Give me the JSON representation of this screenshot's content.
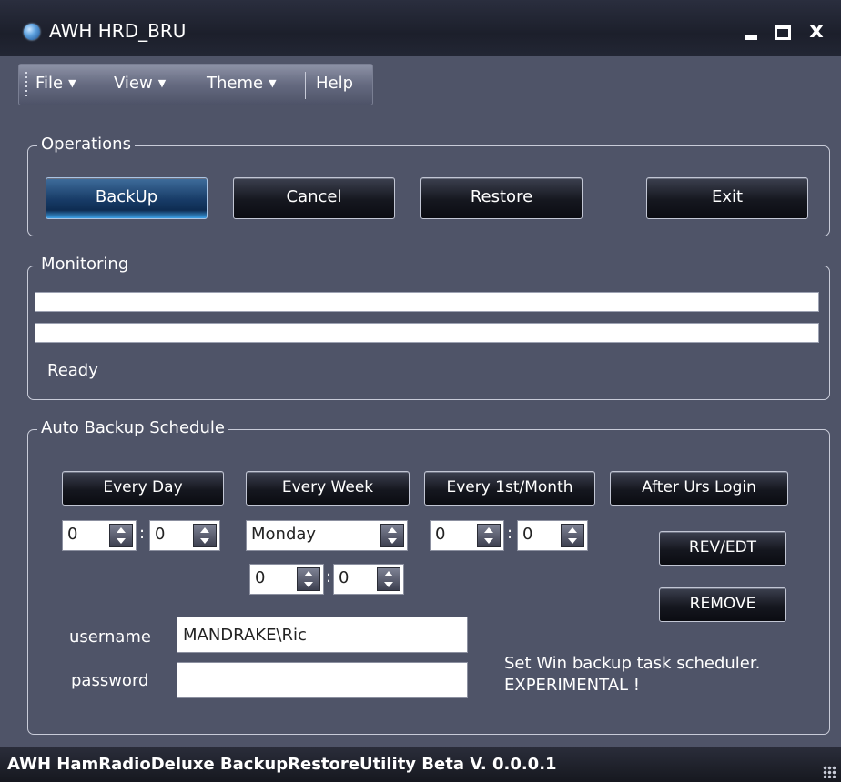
{
  "window": {
    "title": "AWH HRD_BRU",
    "close_label": "x"
  },
  "menu": {
    "items": [
      {
        "label": "File",
        "has_dropdown": true
      },
      {
        "label": "View",
        "has_dropdown": true
      },
      {
        "label": "Theme",
        "has_dropdown": true
      },
      {
        "label": "Help",
        "has_dropdown": false
      }
    ]
  },
  "operations": {
    "legend": "Operations",
    "backup_label": "BackUp",
    "cancel_label": "Cancel",
    "restore_label": "Restore",
    "exit_label": "Exit"
  },
  "monitoring": {
    "legend": "Monitoring",
    "progress1": 0,
    "progress2": 0,
    "status": "Ready"
  },
  "schedule": {
    "legend": "Auto Backup Schedule",
    "every_day_label": "Every Day",
    "every_week_label": "Every Week",
    "every_month_label": "Every 1st/Month",
    "after_login_label": "After Urs Login",
    "day_hour": "0",
    "day_minute": "0",
    "week_day": "Monday",
    "week_hour": "0",
    "week_minute": "0",
    "month_hour": "0",
    "month_minute": "0",
    "time_separator": ":",
    "rev_edt_label": "REV/EDT",
    "remove_label": "REMOVE",
    "username_label": "username",
    "username_value": "MANDRAKE\\Ric",
    "password_label": "password",
    "password_value": "",
    "note_line1": "Set Win backup task scheduler.",
    "note_line2": "EXPERIMENTAL !"
  },
  "statusbar": {
    "text": "AWH HamRadioDeluxe BackupRestoreUtility Beta V. 0.0.0.1"
  },
  "colors": {
    "background": "#4f5468",
    "accent": "#3da0e6",
    "titlebar": "#1c1f2b"
  }
}
